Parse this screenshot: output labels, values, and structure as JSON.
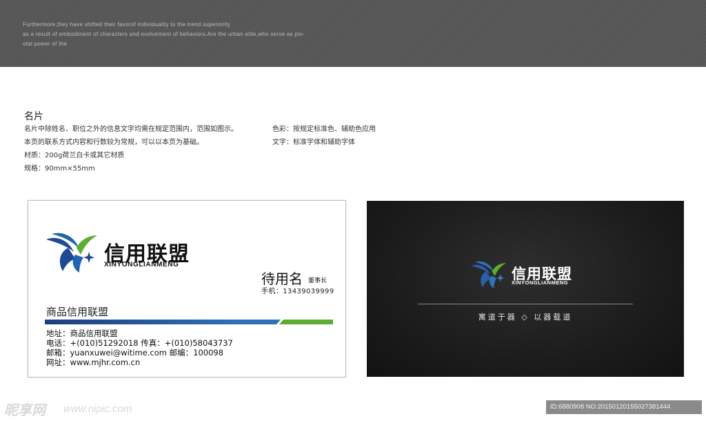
{
  "header": {
    "lines": [
      "Furthermore,they have shifted their favorof individuality to the trend superiority",
      "as a result of embodiment of characters and evolvement of behaviors.Are the urban elite,who serve as piv-",
      "otal power of the"
    ]
  },
  "description": {
    "title": "名片",
    "left_lines": [
      "名片中除姓名、职位之外的信息文字均需在规定范围内，范围如图示。",
      "本页的联系方式内容和行数较为常规，可以以本页为基础。",
      "材质：200g荷兰白卡或其它材质",
      "规格：90mm×55mm"
    ],
    "right_lines": [
      "色彩：按规定标准色、辅助色应用",
      "文字：标准字体和辅助字体"
    ]
  },
  "brand": {
    "name_cn": "信用联盟",
    "name_en": "XINYONGLIANMENG"
  },
  "card_front": {
    "person_name": "待用名",
    "person_title": "董事长",
    "phone": "手机：13439039999",
    "company": "商品信用联盟",
    "info": [
      "地址：商品信用联盟",
      "电话：+(010)51292018  传真：+(010)58043737",
      "邮箱：yuanxuwei@witime.com    邮编：100098",
      "网址：www.mjhr.com.cn"
    ]
  },
  "card_back": {
    "slogan": "寓道于器 ◇ 以器载道"
  },
  "watermark": {
    "logo": "昵享网",
    "url": "www.nipic.com",
    "id": "ID:6880908 NO:20150120155027381444"
  },
  "colors": {
    "brand_blue": "#1d4a92",
    "brand_green": "#5cae2e",
    "back_card": "#1c1c1c"
  }
}
